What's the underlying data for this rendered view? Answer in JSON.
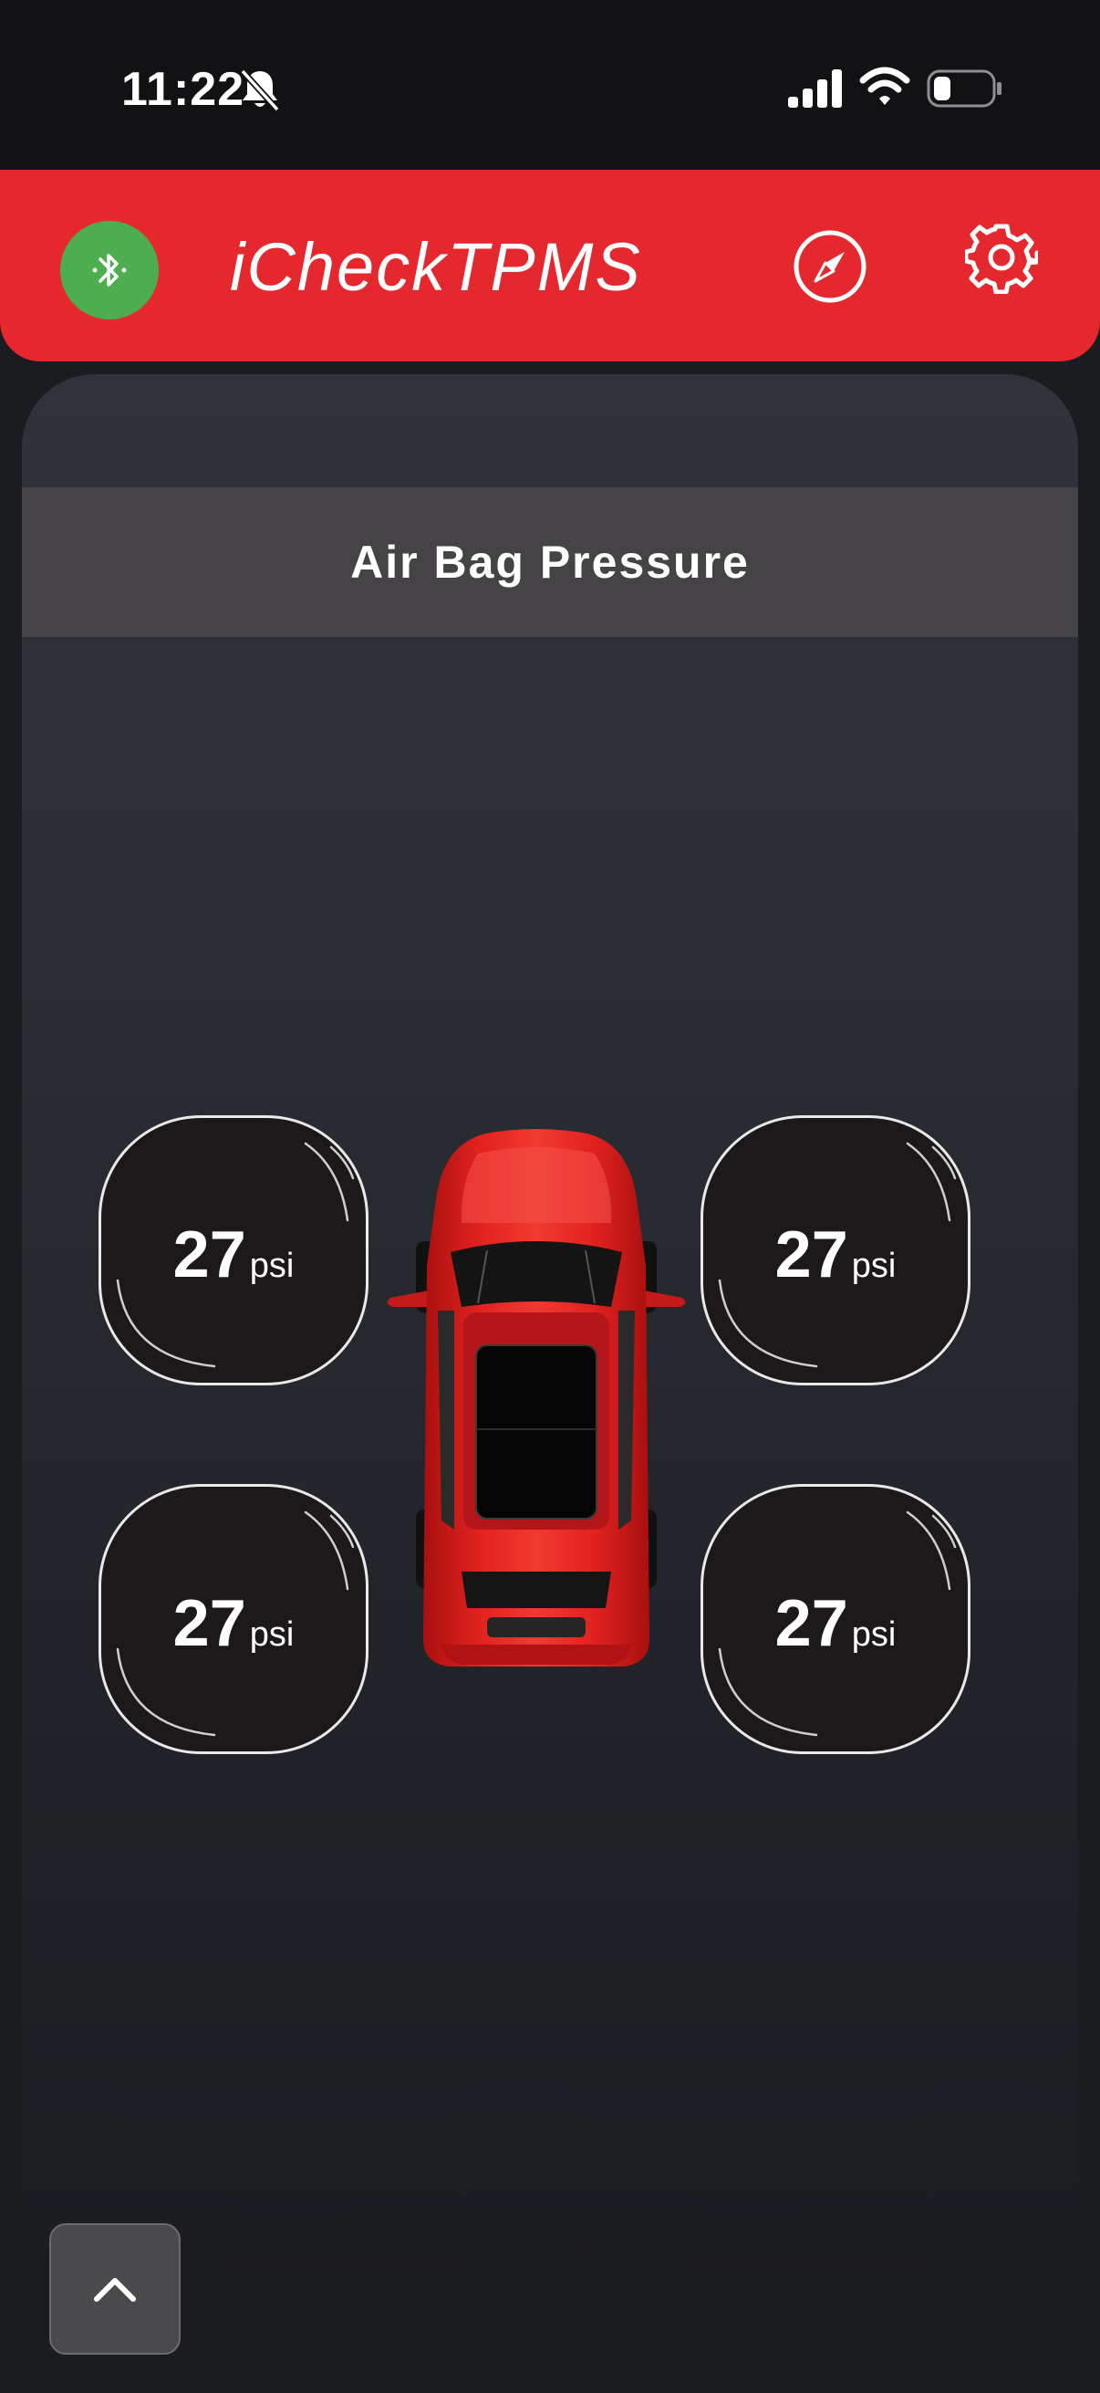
{
  "status_bar": {
    "time": "11:22",
    "icons": [
      "bell-slash-icon",
      "cellular-signal-icon",
      "wifi-icon",
      "battery-icon"
    ]
  },
  "header": {
    "title": "iCheckTPMS",
    "bluetooth_icon": "bluetooth-icon",
    "compass_icon": "compass-icon",
    "settings_icon": "gear-icon"
  },
  "section": {
    "title": "Air Bag Pressure"
  },
  "tires": {
    "front_left": {
      "value": "27",
      "unit": "psi"
    },
    "front_right": {
      "value": "27",
      "unit": "psi"
    },
    "rear_left": {
      "value": "27",
      "unit": "psi"
    },
    "rear_right": {
      "value": "27",
      "unit": "psi"
    }
  },
  "colors": {
    "header_red": "#e4282e",
    "bluetooth_green": "#4cae4f",
    "background_dark": "#1b1c20",
    "section_bar": "#454345",
    "tire_fill": "#1d191a",
    "car_red": "#d8191c"
  },
  "scroll_up_icon": "chevron-up-icon"
}
